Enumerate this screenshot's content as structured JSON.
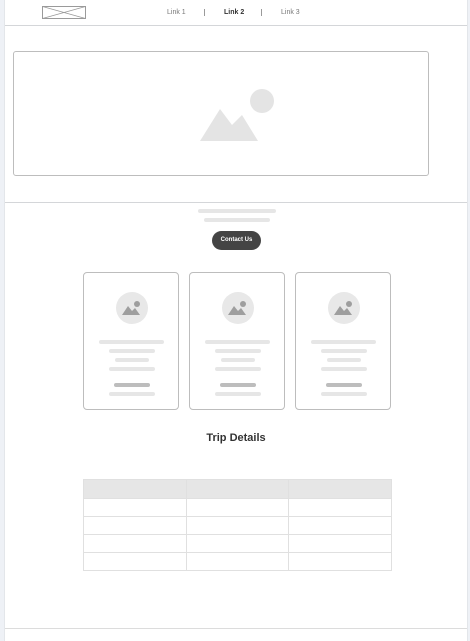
{
  "header": {
    "logo_icon": "image-placeholder-icon",
    "nav": [
      {
        "label": "Link 1",
        "active": false
      },
      {
        "label": "Link 2",
        "active": true
      },
      {
        "label": "Link 3",
        "active": false
      }
    ]
  },
  "hero": {
    "image_icon": "image-placeholder-icon"
  },
  "cta": {
    "contact_label": "Contact Us"
  },
  "cards": [
    {
      "icon": "image-placeholder-icon"
    },
    {
      "icon": "image-placeholder-icon"
    },
    {
      "icon": "image-placeholder-icon"
    }
  ],
  "trip_details": {
    "title": "Trip Details",
    "columns": 3,
    "body_rows": 4
  },
  "colors": {
    "accent_button": "#444444",
    "placeholder": "#e6e6e6",
    "border": "#bdbdbd"
  }
}
